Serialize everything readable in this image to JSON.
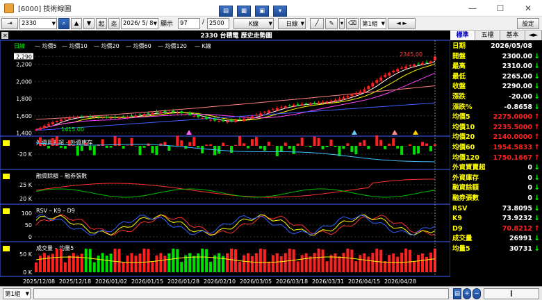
{
  "window": {
    "title": "[6000] 技術線圖"
  },
  "toolbar": {
    "stock_code": "2330",
    "start_label": "起",
    "range_label": "迄",
    "date_value": "2026/ 5/ 8",
    "display_label": "顯示",
    "display_count": "97",
    "total_count": "2500",
    "kline_label": "K線",
    "period_label": "日線",
    "group_label": "第1組",
    "settings_label": "設定"
  },
  "chart": {
    "header": "2330 台積電  歷史走勢圖",
    "period": "日線",
    "legend": [
      "均價5",
      "均價10",
      "均價20",
      "均價60",
      "均價120",
      "K線"
    ],
    "legend_colors": [
      "#ffffff",
      "#ffff00",
      "#ff40ff",
      "#ff8080",
      "#4060ff",
      "#ffffff"
    ],
    "price_axis": [
      "2,290",
      "2,200",
      "2,000",
      "1,800",
      "1,600",
      "1,400"
    ],
    "high_label": "2345.00",
    "low_label": "1415.00",
    "panels": [
      {
        "title": "外資買賣超 – 外資庫存",
        "axis": [
          "-20 K"
        ]
      },
      {
        "title": "融資餘額 – 融券張數",
        "axis": [
          "25 K",
          "20 K"
        ]
      },
      {
        "title": "RSV – K9 – D9",
        "axis": [
          "100",
          "50",
          "0"
        ]
      },
      {
        "title": "成交量 – 均量5",
        "axis": [
          "50 K",
          "0 K"
        ]
      }
    ],
    "dates": [
      "2025/12/08",
      "2025/12/18",
      "2026/01/02",
      "2026/01/15",
      "2026/01/28",
      "2026/02/10",
      "2026/03/05",
      "2026/03/18",
      "2026/03/31",
      "2026/04/15",
      "2026/04/28"
    ]
  },
  "right_panel": {
    "tabs": [
      "標準",
      "五檔",
      "基本"
    ],
    "rows": [
      {
        "label": "日期",
        "value": "2026/05/08",
        "dir": ""
      },
      {
        "label": "開盤",
        "value": "2300.00",
        "dir": "down"
      },
      {
        "label": "最高",
        "value": "2310.00",
        "dir": "down"
      },
      {
        "label": "最低",
        "value": "2265.00",
        "dir": "down"
      },
      {
        "label": "收盤",
        "value": "2290.00",
        "dir": "down"
      },
      {
        "label": "漲跌",
        "value": "-20.00",
        "dir": "down"
      },
      {
        "label": "漲跌%",
        "value": "-0.8658",
        "dir": "down"
      },
      {
        "label": "均價5",
        "value": "2275.0000",
        "dir": "up"
      },
      {
        "label": "均價10",
        "value": "2235.5000",
        "dir": "up"
      },
      {
        "label": "均價20",
        "value": "2140.0000",
        "dir": "up"
      },
      {
        "label": "均價60",
        "value": "1954.5833",
        "dir": "up"
      },
      {
        "label": "均價120",
        "value": "1750.1667",
        "dir": "up"
      },
      {
        "label": "外資買賣超",
        "value": "0",
        "dir": "down"
      },
      {
        "label": "外資庫存",
        "value": "0",
        "dir": "down"
      },
      {
        "label": "融資餘額",
        "value": "0",
        "dir": "down"
      },
      {
        "label": "融券張數",
        "value": "0",
        "dir": "down"
      },
      {
        "label": "RSV",
        "value": "73.8095",
        "dir": "down"
      },
      {
        "label": "K9",
        "value": "73.9232",
        "dir": "down"
      },
      {
        "label": "D9",
        "value": "70.8212",
        "dir": "up"
      },
      {
        "label": "成交量",
        "value": "26991",
        "dir": "down"
      },
      {
        "label": "均量5",
        "value": "30731",
        "dir": "down"
      }
    ]
  },
  "statusbar": {
    "group": "第1組"
  }
}
